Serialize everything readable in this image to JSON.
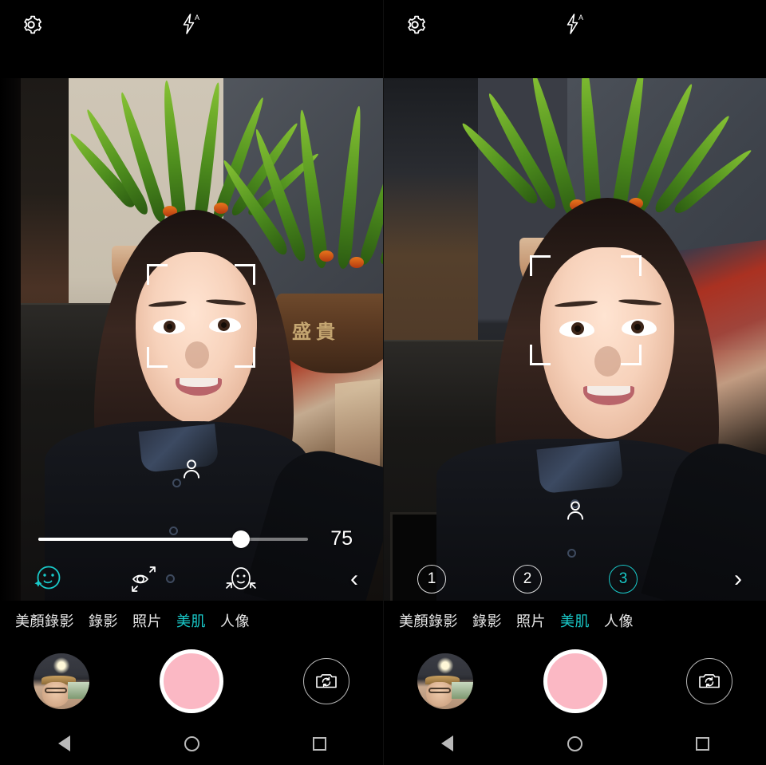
{
  "app": {
    "name": "Camera",
    "accent_teal": "#19c9c9",
    "shutter_pink": "#fbb8c4"
  },
  "topbar": {
    "settings_icon": "gear-icon",
    "flash_icon": "flash-auto-icon",
    "flash_label": "A"
  },
  "viewfinder": {
    "face_detect": "face-detection-brackets",
    "portrait_indicator_icon": "person-icon"
  },
  "left_panel": {
    "slider": {
      "name": "beauty-level-slider",
      "value": "75",
      "min": 0,
      "max": 100,
      "percent": 75
    },
    "tools": [
      {
        "id": "smooth-skin",
        "icon": "smiley-sparkle-icon",
        "active": true
      },
      {
        "id": "enlarge-eyes",
        "icon": "eye-enlarge-icon",
        "active": false
      },
      {
        "id": "slim-face",
        "icon": "face-slim-icon",
        "active": false
      }
    ],
    "nav_arrow": "‹",
    "nav_arrow_name": "prev-page-chevron"
  },
  "right_panel": {
    "levels": [
      {
        "label": "1",
        "active": false
      },
      {
        "label": "2",
        "active": false
      },
      {
        "label": "3",
        "active": true
      }
    ],
    "nav_arrow": "›",
    "nav_arrow_name": "next-page-chevron"
  },
  "modes": [
    {
      "label": "美顏錄影",
      "active": false
    },
    {
      "label": "錄影",
      "active": false
    },
    {
      "label": "照片",
      "active": false
    },
    {
      "label": "美肌",
      "active": true
    },
    {
      "label": "人像",
      "active": false
    }
  ],
  "controls": {
    "gallery_thumbnail": "gallery-thumbnail",
    "shutter": "shutter-button",
    "flip_camera": "switch-camera-icon"
  },
  "navbar": {
    "back": "back-button",
    "home": "home-button",
    "recents": "recents-button"
  },
  "scene": {
    "pot_text": "盛貴"
  }
}
